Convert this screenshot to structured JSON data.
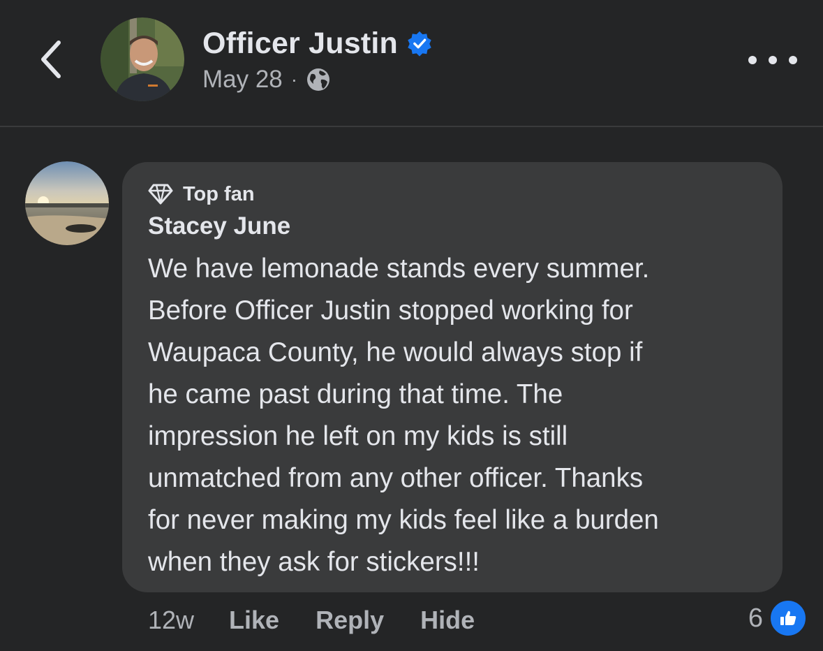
{
  "header": {
    "author_name": "Officer Justin",
    "date": "May 28",
    "separator": "·",
    "verified_color": "#1877f2",
    "icons": [
      "back-chevron-icon",
      "verified-badge-icon",
      "globe-icon",
      "more-options-icon"
    ]
  },
  "comment": {
    "badge_label": "Top fan",
    "badge_icon": "diamond-icon",
    "author": "Stacey June",
    "lines": [
      "We have lemonade stands every summer.",
      "Before Officer Justin stopped working for",
      "Waupaca County, he would always stop if",
      "he came past during that time. The",
      "impression he left on my kids is still",
      "unmatched from any other officer. Thanks",
      "for never making my kids feel like a burden",
      "when they ask for stickers!!!"
    ],
    "timestamp": "12w",
    "actions": {
      "like": "Like",
      "reply": "Reply",
      "hide": "Hide"
    },
    "reaction_count": "6",
    "reaction_icon": "like-thumb-icon",
    "reaction_color": "#1877f2"
  },
  "theme": {
    "background": "#242526",
    "bubble": "#3a3b3c",
    "primary_text": "#e4e6eb",
    "secondary_text": "#b0b3b8"
  }
}
